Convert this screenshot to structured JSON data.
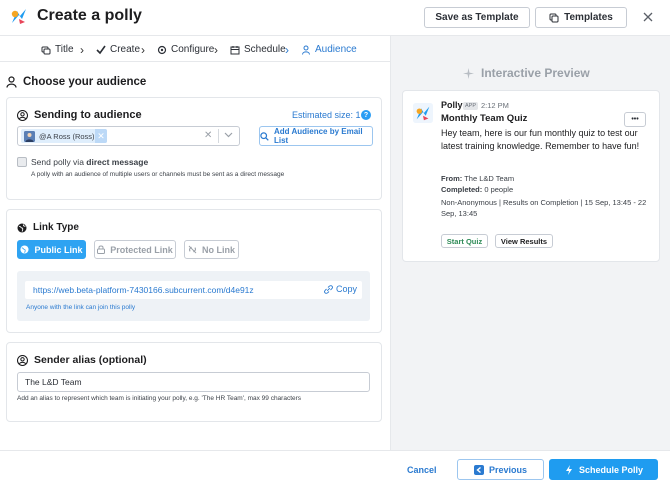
{
  "header": {
    "title": "Create a polly",
    "save_template_label": "Save as Template",
    "templates_label": "Templates"
  },
  "steps": [
    {
      "label": "Title"
    },
    {
      "label": "Create"
    },
    {
      "label": "Configure"
    },
    {
      "label": "Schedule"
    },
    {
      "label": "Audience"
    }
  ],
  "audience": {
    "heading": "Choose your audience",
    "sending_heading": "Sending to audience",
    "estimated_size": "Estimated size: 1",
    "chip_label": "@A Ross (Ross)",
    "add_email_label": "Add Audience by Email List",
    "dm_label_prefix": "Send polly via ",
    "dm_label_bold": "direct message",
    "dm_hint": "A polly with an audience of multiple users or channels must be sent as a direct message"
  },
  "link_type": {
    "heading": "Link Type",
    "options": [
      "Public Link",
      "Protected Link",
      "No Link"
    ],
    "url": "https://web.beta-platform-7430166.subcurrent.com/d4e91z",
    "copy_label": "Copy",
    "hint": "Anyone with the link can join this polly"
  },
  "sender_alias": {
    "heading": "Sender alias (optional)",
    "value": "The L&D Team",
    "hint": "Add an alias to represent which team is initiating your polly, e.g. 'The HR Team', max 99 characters"
  },
  "preview": {
    "heading": "Interactive Preview",
    "app_name": "Polly",
    "app_badge": "APP",
    "time": "2:12 PM",
    "poll_title": "Monthly Team Quiz",
    "message": "Hey team, here is our fun monthly quiz to test our latest training knowledge. Remember to have fun!",
    "from_label": "From:",
    "from_value": " The L&D Team",
    "completed_label": "Completed:",
    "completed_value": " 0 people",
    "meta": "Non-Anonymous | Results on Completion | 15 Sep, 13:45 - 22 Sep, 13:45",
    "start_label": "Start Quiz",
    "results_label": "View Results",
    "more_label": "•••"
  },
  "footer": {
    "cancel_label": "Cancel",
    "previous_label": "Previous",
    "schedule_label": "Schedule Polly"
  },
  "colors": {
    "accent": "#1f9cf0",
    "link": "#2a7ad0",
    "preview_bg": "#f2f3f5"
  }
}
